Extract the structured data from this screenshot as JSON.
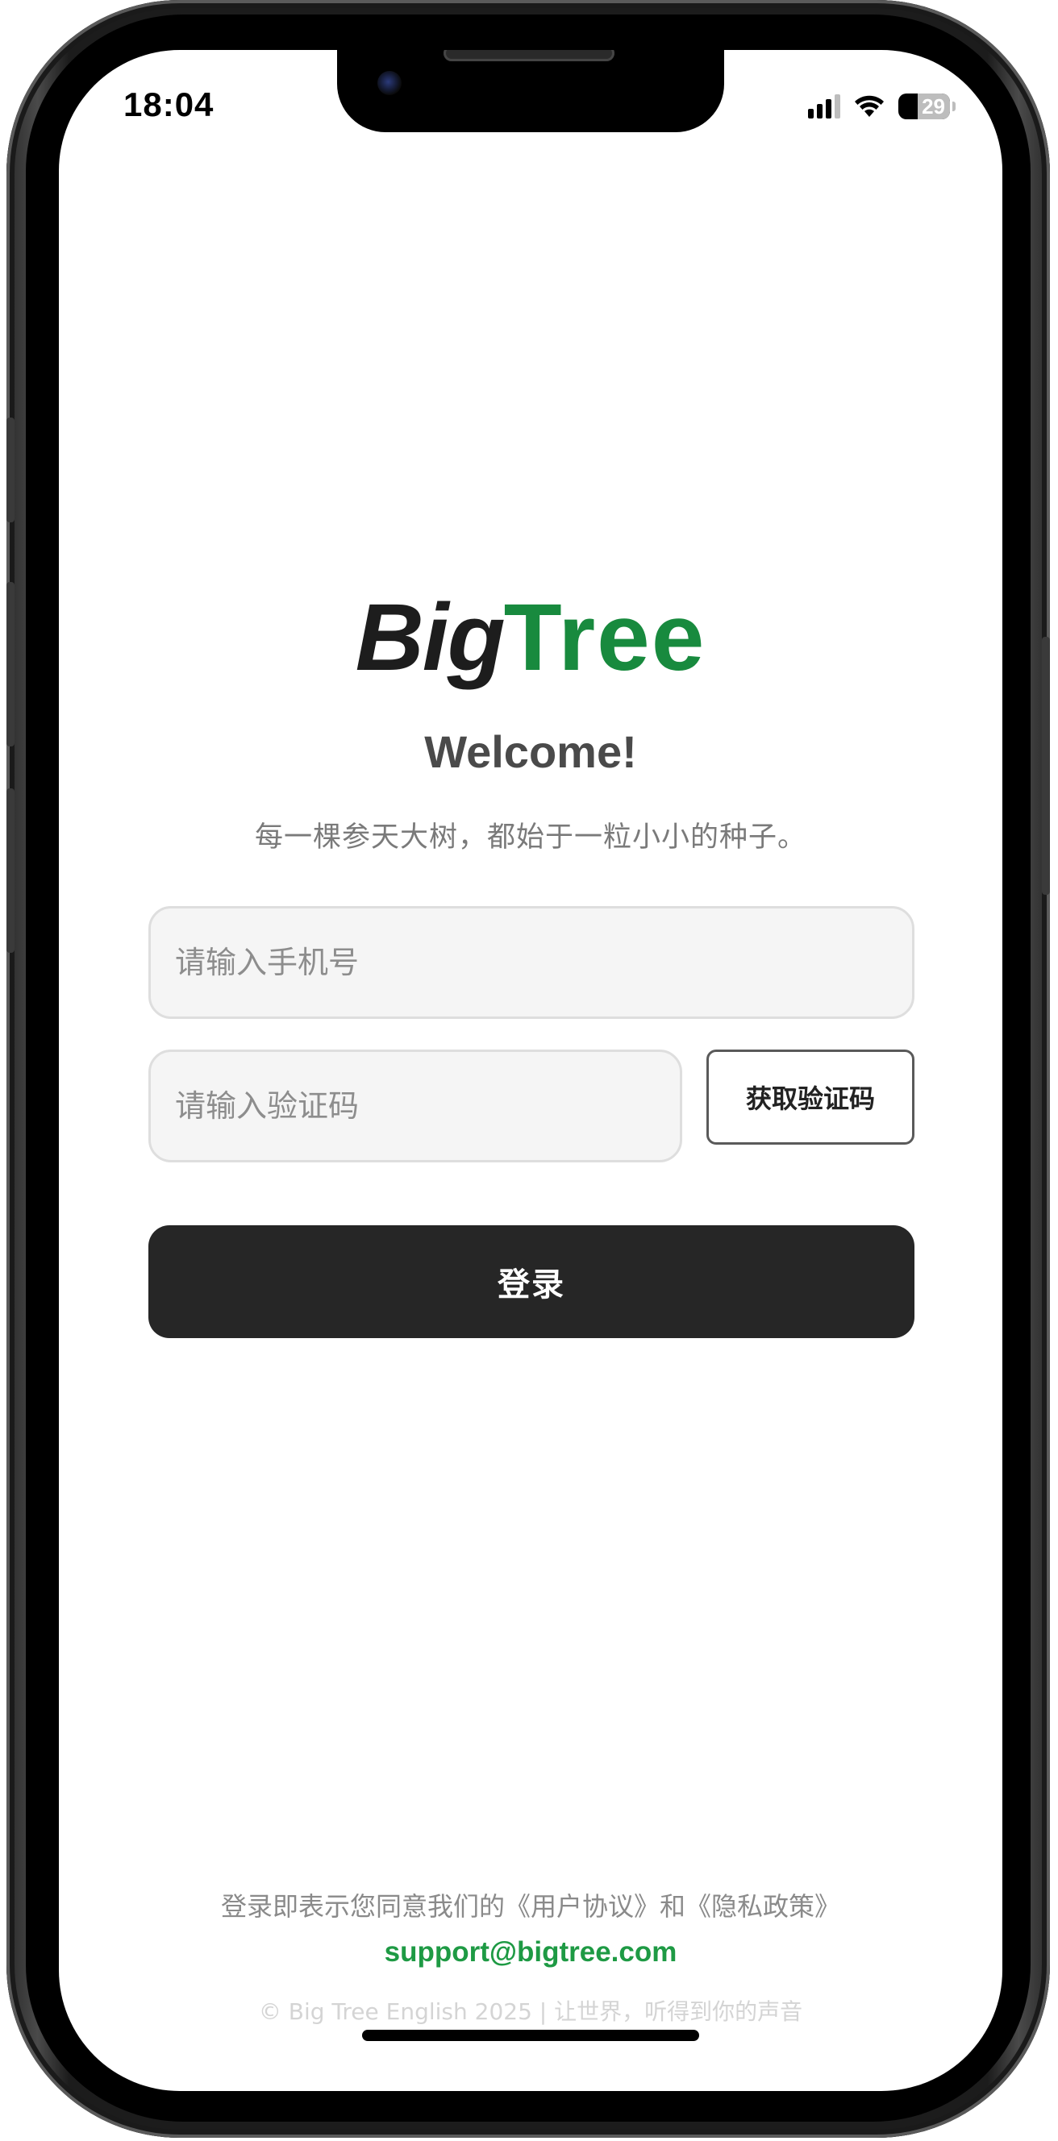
{
  "status_bar": {
    "time": "18:04",
    "battery_level": "29",
    "icons": [
      "cellular-signal-icon",
      "wifi-icon",
      "battery-icon"
    ]
  },
  "brand": {
    "name_part1": "Big",
    "name_part2": "Tree",
    "primary_color": "#188a3e"
  },
  "welcome": {
    "title": "Welcome!",
    "slogan": "每一棵参天大树，都始于一粒小小的种子。"
  },
  "form": {
    "phone_placeholder": "请输入手机号",
    "phone_value": "",
    "code_placeholder": "请输入验证码",
    "code_value": "",
    "get_code_label": "获取验证码",
    "login_label": "登录"
  },
  "footer": {
    "agreement": "登录即表示您同意我们的《用户协议》和《隐私政策》",
    "support_email": "support@bigtree.com",
    "copyright": "© Big Tree English 2025 | 让世界，听得到你的声音"
  }
}
